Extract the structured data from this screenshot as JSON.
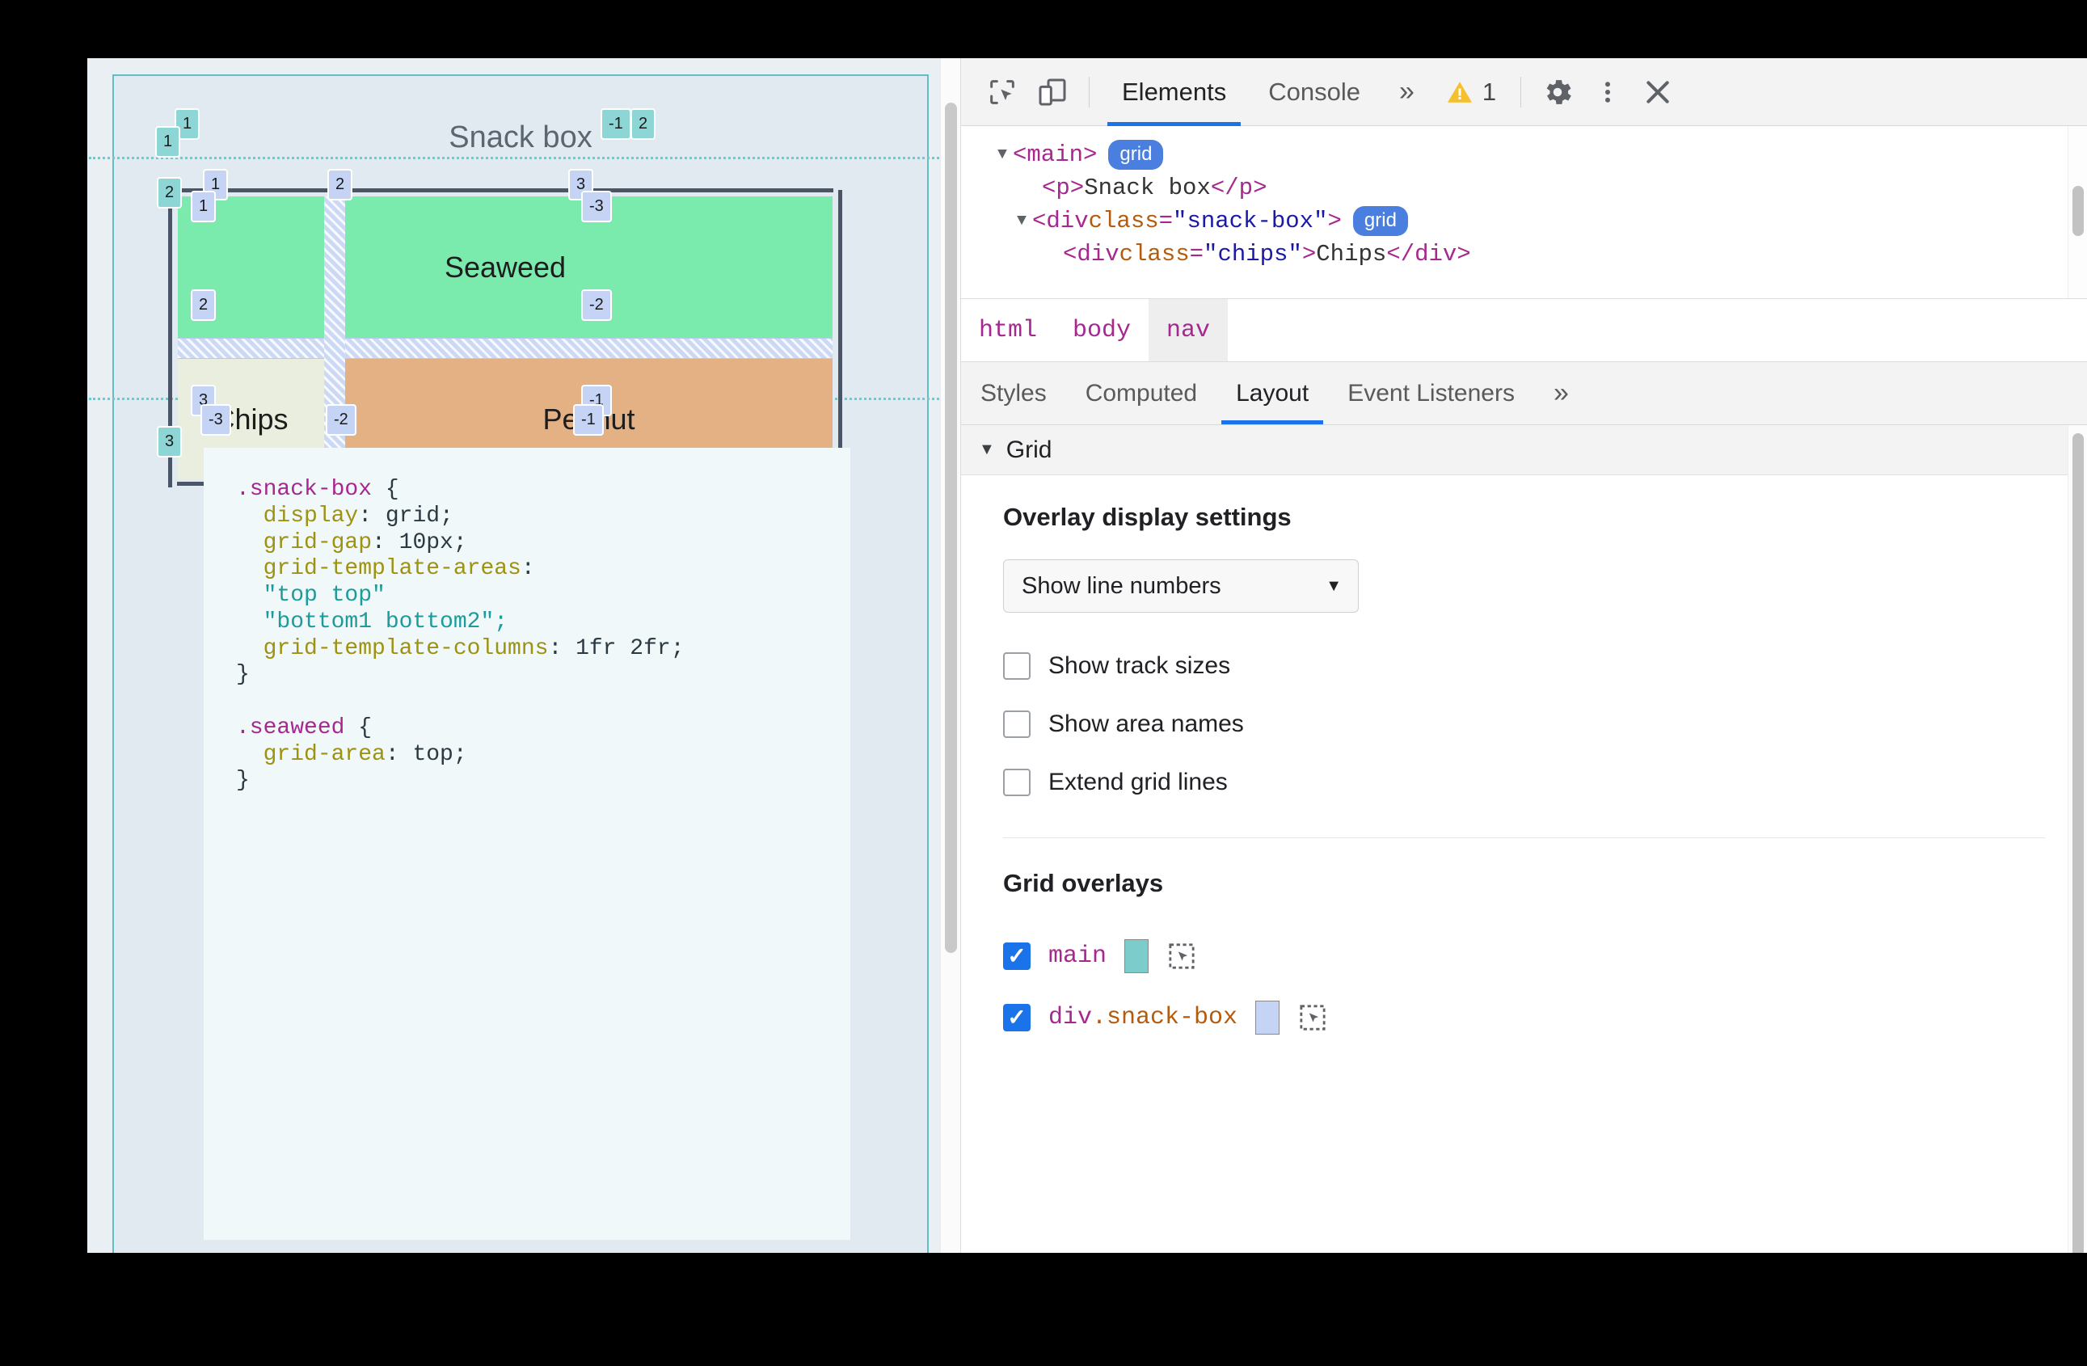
{
  "viewport": {
    "page_title": "Snack box",
    "cells": [
      {
        "name": "Seaweed"
      },
      {
        "name": "Chips"
      },
      {
        "name": "Peanut"
      }
    ],
    "main_line_badges": [
      "1",
      "1",
      "-1",
      "2",
      "2",
      "3"
    ],
    "snackbox_line_badges": [
      "1",
      "2",
      "3",
      "1",
      "-3",
      "2",
      "-2",
      "3",
      "-1",
      "-3",
      "-2",
      "-1"
    ],
    "css_code": [
      {
        "sel": ".snack-box",
        "open": " {"
      },
      {
        "prop": "  display",
        "val": ": grid;"
      },
      {
        "prop": "  grid-gap",
        "val": ": 10px;"
      },
      {
        "prop": "  grid-template-areas",
        "val": ":"
      },
      {
        "str": "  \"top top\""
      },
      {
        "str": "  \"bottom1 bottom2\";"
      },
      {
        "prop": "  grid-template-columns",
        "val": ": 1fr 2fr;"
      },
      {
        "close": "}"
      }
    ],
    "css_code_2": [
      {
        "sel": ".seaweed",
        "open": " {"
      },
      {
        "prop": "  grid-area",
        "val": ": top;"
      },
      {
        "close": "}"
      }
    ],
    "colors": {
      "seaweed": "#7BEBAD",
      "chips": "#E9EEDE",
      "peanut": "#E3B183",
      "main_overlay": "#7CCCCC",
      "snackbox_overlay": "#C5D4F5",
      "page_bg": "#EAEFF3",
      "main_bg": "#E0EAF0",
      "code_bg": "#F0F8FA"
    }
  },
  "devtools": {
    "toolbar": {
      "inspect_icon": "inspect-element-icon",
      "device_icon": "device-toolbar-icon",
      "tabs": [
        {
          "label": "Elements",
          "active": true
        },
        {
          "label": "Console",
          "active": false
        }
      ],
      "more_tabs": "»",
      "warning_count": "1",
      "settings_icon": "gear-icon",
      "kebab_icon": "more-vertical-icon",
      "close_icon": "close-icon"
    },
    "dom_tree": [
      {
        "indent": 0,
        "triangle": "▼",
        "parts": [
          {
            "t": "tag",
            "v": "<main>"
          }
        ],
        "badge": "grid"
      },
      {
        "indent": 1,
        "triangle": "",
        "parts": [
          {
            "t": "tag",
            "v": "<p>"
          },
          {
            "t": "txt",
            "v": "Snack box"
          },
          {
            "t": "tag",
            "v": "</p>"
          }
        ],
        "badge": ""
      },
      {
        "indent": 1,
        "triangle": "▼",
        "parts": [
          {
            "t": "tag",
            "v": "<div "
          },
          {
            "t": "attr",
            "v": "class"
          },
          {
            "t": "tag",
            "v": "="
          },
          {
            "t": "attrval",
            "v": "\"snack-box\""
          },
          {
            "t": "tag",
            "v": ">"
          }
        ],
        "badge": "grid"
      },
      {
        "indent": 2,
        "triangle": "",
        "parts": [
          {
            "t": "tag",
            "v": "<div "
          },
          {
            "t": "attr",
            "v": "class"
          },
          {
            "t": "tag",
            "v": "="
          },
          {
            "t": "attrval",
            "v": "\"chips\""
          },
          {
            "t": "tag",
            "v": ">"
          },
          {
            "t": "txt",
            "v": "Chips"
          },
          {
            "t": "tag",
            "v": "</div>"
          }
        ],
        "badge": ""
      }
    ],
    "breadcrumb": [
      {
        "label": "html",
        "selected": false
      },
      {
        "label": "body",
        "selected": false
      },
      {
        "label": "nav",
        "selected": true
      }
    ],
    "sub_tabs": [
      {
        "label": "Styles",
        "active": false
      },
      {
        "label": "Computed",
        "active": false
      },
      {
        "label": "Layout",
        "active": true
      },
      {
        "label": "Event Listeners",
        "active": false
      }
    ],
    "sub_tabs_more": "»",
    "layout": {
      "section_title": "Grid",
      "section_caret": "▼",
      "overlay_settings_title": "Overlay display settings",
      "select_value": "Show line numbers",
      "select_arrow": "▼",
      "checkboxes": [
        {
          "label": "Show track sizes",
          "checked": false
        },
        {
          "label": "Show area names",
          "checked": false
        },
        {
          "label": "Extend grid lines",
          "checked": false
        }
      ],
      "overlays_title": "Grid overlays",
      "overlays": [
        {
          "checked": true,
          "tag": "main",
          "cls": "",
          "color": "#7CCCCC",
          "picker_icon": "node-picker-icon"
        },
        {
          "checked": true,
          "tag": "div",
          "cls": ".snack-box",
          "color": "#C5D4F5",
          "picker_icon": "node-picker-icon"
        }
      ]
    }
  }
}
